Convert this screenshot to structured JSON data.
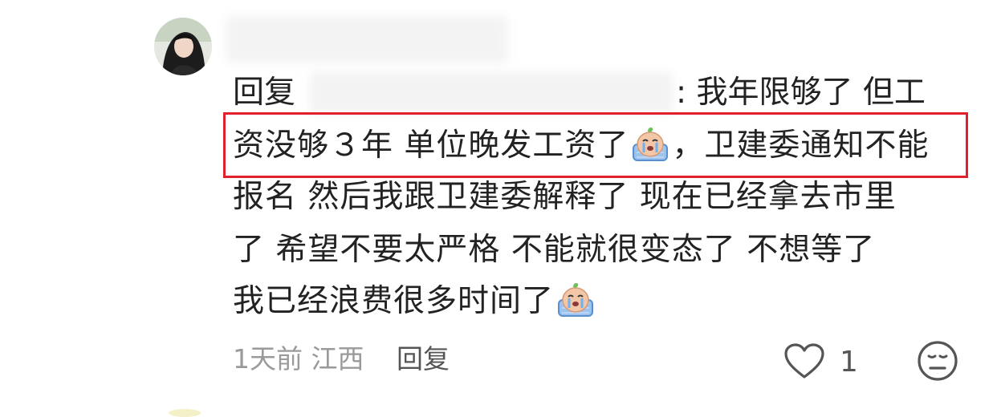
{
  "comment": {
    "reply_prefix": "回复",
    "reply_text_end": ": 我年限够了 但工",
    "lines": [
      "资没够３年  单位晚发工资了",
      "，卫建委通知不能",
      "报名  然后我跟卫建委解释了  现在已经拿去市里",
      "了   希望不要太严格  不能就很变态了  不想等了",
      "我已经浪费很多时间了"
    ],
    "emoji_name": "crying-face-sticker"
  },
  "meta": {
    "time": "1天前",
    "location": "江西",
    "reply_label": "回复",
    "like_count": "1"
  },
  "colors": {
    "highlight": "#e0202a",
    "meta_text": "#9a9a9a"
  }
}
